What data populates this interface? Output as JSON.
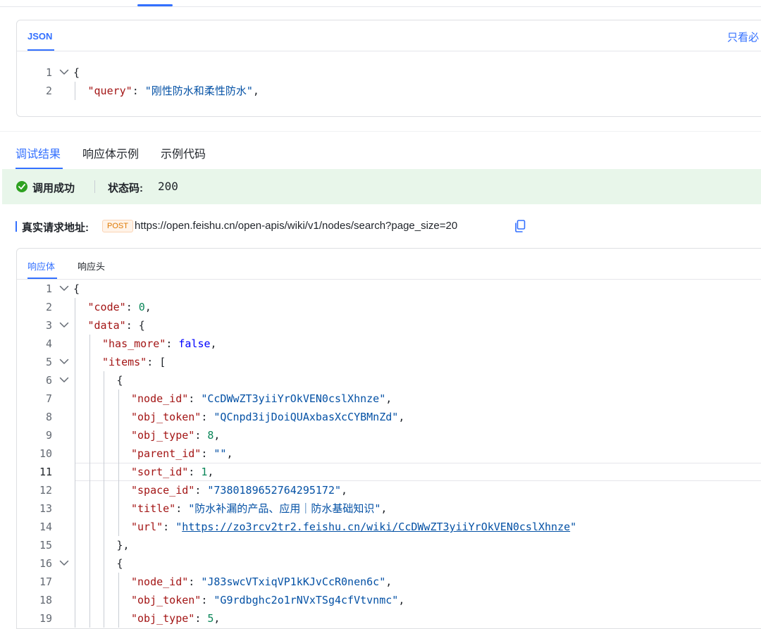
{
  "request": {
    "tab_label": "JSON",
    "only_required_label": "只看必",
    "lines": [
      {
        "no": "1",
        "fold": true,
        "indent": 0,
        "tokens": [
          {
            "t": "{",
            "c": "p"
          }
        ]
      },
      {
        "no": "2",
        "fold": false,
        "indent": 1,
        "tokens": [
          {
            "t": "\"query\"",
            "c": "k"
          },
          {
            "t": ": ",
            "c": "p"
          },
          {
            "t": "\"刚性防水和柔性防水\"",
            "c": "s"
          },
          {
            "t": ",",
            "c": "p"
          }
        ]
      }
    ]
  },
  "result_tabs": [
    {
      "label": "调试结果",
      "active": true
    },
    {
      "label": "响应体示例",
      "active": false
    },
    {
      "label": "示例代码",
      "active": false
    }
  ],
  "banner": {
    "success_text": "调用成功",
    "status_label": "状态码:",
    "status_code": "200"
  },
  "address": {
    "label": "真实请求地址:",
    "method": "POST",
    "url": "https://open.feishu.cn/open-apis/wiki/v1/nodes/search?page_size=20"
  },
  "response": {
    "tabs": [
      {
        "label": "响应体",
        "active": true
      },
      {
        "label": "响应头",
        "active": false
      }
    ],
    "current_line": "11",
    "lines": [
      {
        "no": "1",
        "fold": true,
        "indent": 0,
        "tokens": [
          {
            "t": "{",
            "c": "p"
          }
        ]
      },
      {
        "no": "2",
        "fold": false,
        "indent": 1,
        "tokens": [
          {
            "t": "\"code\"",
            "c": "k"
          },
          {
            "t": ": ",
            "c": "p"
          },
          {
            "t": "0",
            "c": "n"
          },
          {
            "t": ",",
            "c": "p"
          }
        ]
      },
      {
        "no": "3",
        "fold": true,
        "indent": 1,
        "tokens": [
          {
            "t": "\"data\"",
            "c": "k"
          },
          {
            "t": ": {",
            "c": "p"
          }
        ]
      },
      {
        "no": "4",
        "fold": false,
        "indent": 2,
        "tokens": [
          {
            "t": "\"has_more\"",
            "c": "k"
          },
          {
            "t": ": ",
            "c": "p"
          },
          {
            "t": "false",
            "c": "b"
          },
          {
            "t": ",",
            "c": "p"
          }
        ]
      },
      {
        "no": "5",
        "fold": true,
        "indent": 2,
        "tokens": [
          {
            "t": "\"items\"",
            "c": "k"
          },
          {
            "t": ": [",
            "c": "p"
          }
        ]
      },
      {
        "no": "6",
        "fold": true,
        "indent": 3,
        "tokens": [
          {
            "t": "{",
            "c": "p"
          }
        ]
      },
      {
        "no": "7",
        "fold": false,
        "indent": 4,
        "tokens": [
          {
            "t": "\"node_id\"",
            "c": "k"
          },
          {
            "t": ": ",
            "c": "p"
          },
          {
            "t": "\"CcDWwZT3yiiYrOkVEN0cslXhnze\"",
            "c": "s"
          },
          {
            "t": ",",
            "c": "p"
          }
        ]
      },
      {
        "no": "8",
        "fold": false,
        "indent": 4,
        "tokens": [
          {
            "t": "\"obj_token\"",
            "c": "k"
          },
          {
            "t": ": ",
            "c": "p"
          },
          {
            "t": "\"QCnpd3ijDoiQUAxbasXcCYBMnZd\"",
            "c": "s"
          },
          {
            "t": ",",
            "c": "p"
          }
        ]
      },
      {
        "no": "9",
        "fold": false,
        "indent": 4,
        "tokens": [
          {
            "t": "\"obj_type\"",
            "c": "k"
          },
          {
            "t": ": ",
            "c": "p"
          },
          {
            "t": "8",
            "c": "n"
          },
          {
            "t": ",",
            "c": "p"
          }
        ]
      },
      {
        "no": "10",
        "fold": false,
        "indent": 4,
        "tokens": [
          {
            "t": "\"parent_id\"",
            "c": "k"
          },
          {
            "t": ": ",
            "c": "p"
          },
          {
            "t": "\"\"",
            "c": "s"
          },
          {
            "t": ",",
            "c": "p"
          }
        ]
      },
      {
        "no": "11",
        "fold": false,
        "indent": 4,
        "tokens": [
          {
            "t": "\"sort_id\"",
            "c": "k"
          },
          {
            "t": ": ",
            "c": "p"
          },
          {
            "t": "1",
            "c": "n"
          },
          {
            "t": ",",
            "c": "p"
          }
        ]
      },
      {
        "no": "12",
        "fold": false,
        "indent": 4,
        "tokens": [
          {
            "t": "\"space_id\"",
            "c": "k"
          },
          {
            "t": ": ",
            "c": "p"
          },
          {
            "t": "\"7380189652764295172\"",
            "c": "s"
          },
          {
            "t": ",",
            "c": "p"
          }
        ]
      },
      {
        "no": "13",
        "fold": false,
        "indent": 4,
        "tokens": [
          {
            "t": "\"title\"",
            "c": "k"
          },
          {
            "t": ": ",
            "c": "p"
          },
          {
            "t": "\"防水补漏的产品、应用｜防水基础知识\"",
            "c": "s"
          },
          {
            "t": ",",
            "c": "p"
          }
        ]
      },
      {
        "no": "14",
        "fold": false,
        "indent": 4,
        "tokens": [
          {
            "t": "\"url\"",
            "c": "k"
          },
          {
            "t": ": ",
            "c": "p"
          },
          {
            "t": "\"",
            "c": "s"
          },
          {
            "t": "https://zo3rcv2tr2.feishu.cn/wiki/CcDWwZT3yiiYrOkVEN0cslXhnze",
            "c": "lnk"
          },
          {
            "t": "\"",
            "c": "s"
          }
        ]
      },
      {
        "no": "15",
        "fold": false,
        "indent": 3,
        "tokens": [
          {
            "t": "},",
            "c": "p"
          }
        ]
      },
      {
        "no": "16",
        "fold": true,
        "indent": 3,
        "tokens": [
          {
            "t": "{",
            "c": "p"
          }
        ]
      },
      {
        "no": "17",
        "fold": false,
        "indent": 4,
        "tokens": [
          {
            "t": "\"node_id\"",
            "c": "k"
          },
          {
            "t": ": ",
            "c": "p"
          },
          {
            "t": "\"J83swcVTxiqVP1kKJvCcR0nen6c\"",
            "c": "s"
          },
          {
            "t": ",",
            "c": "p"
          }
        ]
      },
      {
        "no": "18",
        "fold": false,
        "indent": 4,
        "tokens": [
          {
            "t": "\"obj_token\"",
            "c": "k"
          },
          {
            "t": ": ",
            "c": "p"
          },
          {
            "t": "\"G9rdbghc2o1rNVxTSg4cfVtvnmc\"",
            "c": "s"
          },
          {
            "t": ",",
            "c": "p"
          }
        ]
      },
      {
        "no": "19",
        "fold": false,
        "indent": 4,
        "tokens": [
          {
            "t": "\"obj_type\"",
            "c": "k"
          },
          {
            "t": ": ",
            "c": "p"
          },
          {
            "t": "5",
            "c": "n"
          },
          {
            "t": ",",
            "c": "p"
          }
        ]
      }
    ]
  },
  "colors": {
    "accent": "#3370ff",
    "success": "#2ea121",
    "banner_bg": "#e8f6ea",
    "json_key": "#a31515",
    "json_string": "#0451a5",
    "json_number": "#098658",
    "json_boolean": "#0000ff"
  },
  "icons": {
    "fold": "chevron-down-icon",
    "success": "check-circle-icon",
    "copy": "copy-icon"
  }
}
